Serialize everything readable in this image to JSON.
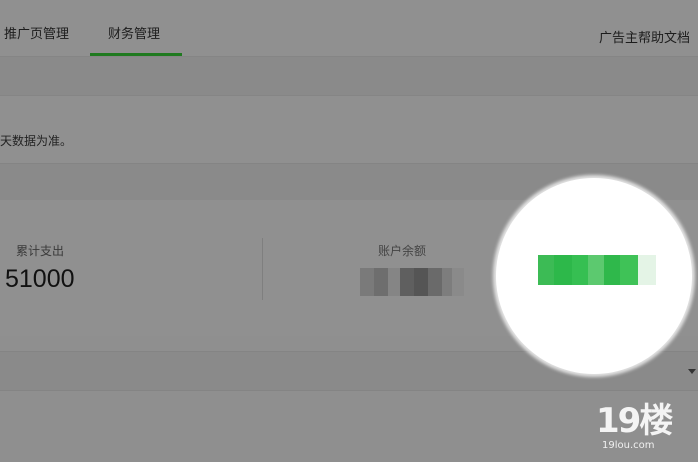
{
  "tabs": [
    {
      "label": "推广页管理",
      "active": false
    },
    {
      "label": "财务管理",
      "active": true
    }
  ],
  "help_link": "广告主帮助文档",
  "notice_text": "天数据为准。",
  "stats": {
    "total_spend_label": "累计支出",
    "total_spend_value": "51000",
    "balance_label": "账户余额"
  },
  "watermark": {
    "logo_text": "19楼",
    "domain": "19lou.com"
  },
  "colors": {
    "accent": "#2db84a",
    "active_tab_underline": "#1f7a1f"
  },
  "icons": {
    "dropdown": "chevron-down-icon"
  }
}
